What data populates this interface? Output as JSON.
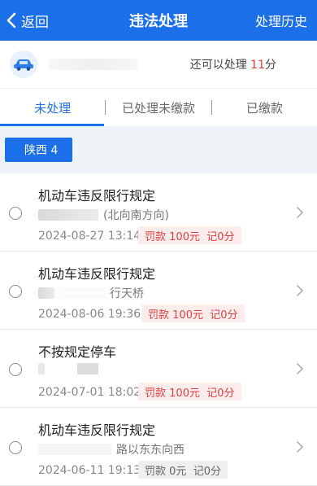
{
  "header": {
    "back_label": "返回",
    "title": "违法处理",
    "history_label": "处理历史"
  },
  "vehicle": {
    "remain_prefix": "还可以处理",
    "remain_count": "11",
    "remain_unit": "分"
  },
  "tabs": [
    {
      "label": "未处理",
      "active": true
    },
    {
      "label": "已处理未缴款",
      "active": false
    },
    {
      "label": "已缴款",
      "active": false
    }
  ],
  "plate_chip": "陕西 4",
  "violations": [
    {
      "title": "机动车违反限行规定",
      "location": "(北向南方向)",
      "date": "2024-08-27 13:14",
      "fine_label": "罚款",
      "fine_amount": "100元",
      "points": "记0分",
      "style": "red"
    },
    {
      "title": "机动车违反限行规定",
      "location": "行天桥",
      "date": "2024-08-06 19:36",
      "fine_label": "罚款",
      "fine_amount": "100元",
      "points": "记0分",
      "style": "red"
    },
    {
      "title": "不按规定停车",
      "location": "",
      "date": "2024-07-01 18:02",
      "fine_label": "罚款",
      "fine_amount": "100元",
      "points": "记0分",
      "style": "red"
    },
    {
      "title": "机动车违反限行规定",
      "location": "路以东东向西",
      "date": "2024-06-11 19:13",
      "fine_label": "罚款",
      "fine_amount": "0元",
      "points": "记0分",
      "style": "grey"
    }
  ],
  "colors": {
    "primary": "#1b6fe8",
    "fine_red": "#e24141",
    "remain_red": "#e23b3b"
  },
  "icons": {
    "back": "chevron-left-icon",
    "car": "car-icon",
    "row_arrow": "chevron-right-icon"
  }
}
